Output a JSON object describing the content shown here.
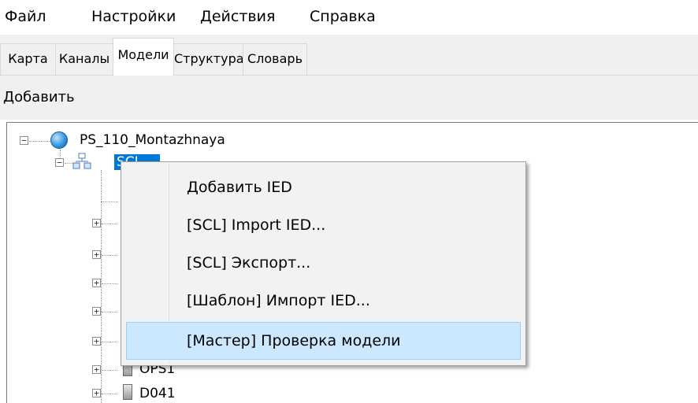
{
  "menubar": {
    "items": [
      "Файл",
      "Настройки",
      "Действия",
      "Справка"
    ]
  },
  "tabs": {
    "items": [
      "Карта",
      "Каналы",
      "Модели",
      "Структура",
      "Словарь"
    ],
    "active": "Модели"
  },
  "toolbar": {
    "add_label": "Добавить"
  },
  "tree": {
    "root_label": "PS_110_Montazhnaya",
    "selected_label": "SCL",
    "children": [
      "OPS1",
      "D041"
    ]
  },
  "context_menu": {
    "items": [
      "Добавить IED",
      "[SCL] Import IED...",
      "[SCL] Экспорт...",
      "[Шаблон] Импорт IED...",
      "[Мастер] Проверка модели"
    ],
    "highlighted": "[Мастер] Проверка модели"
  },
  "colors": {
    "selection": "#0078d7",
    "menu_highlight": "#cce8ff",
    "menu_highlight_border": "#99d1ff",
    "chrome": "#f0f0f0"
  }
}
